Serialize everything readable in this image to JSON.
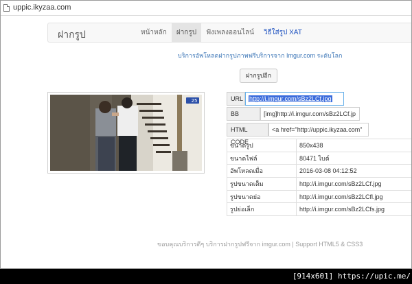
{
  "browser": {
    "url": "uppic.ikyzaa.com"
  },
  "navbar": {
    "brand": "ฝากรูป",
    "items": [
      {
        "label": "หน้าหลัก",
        "active": false
      },
      {
        "label": "ฝากรูป",
        "active": true
      },
      {
        "label": "ฟังเพลงออนไลน์",
        "active": false
      },
      {
        "label": "วิธีใส่รูป XAT",
        "active": false
      }
    ]
  },
  "service_text": "บริการอัพโหลดฝากรูปภาพฟรีบริการจาก Imgur.com ระดับโลก",
  "upload_button": "ฝากรูปอีก",
  "thumbnail": {
    "channel_badge": "25"
  },
  "codes": {
    "url_label": "URL",
    "url_value": "http://i.imgur.com/sBz2LCf.jpg",
    "bb_label": "BB CODE",
    "bb_value": "[img]http://i.imgur.com/sBz2LCf.jp",
    "html_label": "HTML CODE",
    "html_value": "<a href=\"http://uppic.ikyzaa.com\""
  },
  "info_rows": [
    {
      "label": "ขนาดรูป",
      "value": "850x438"
    },
    {
      "label": "ขนาดไฟล์",
      "value": "80471 ไบต์"
    },
    {
      "label": "อัพโหลดเมื่อ",
      "value": "2016-03-08 04:12:52"
    },
    {
      "label": "รูปขนาดเต็ม",
      "value": "http://i.imgur.com/sBz2LCf.jpg"
    },
    {
      "label": "รูปขนาดย่อ",
      "value": "http://i.imgur.com/sBz2LCfl.jpg"
    },
    {
      "label": "รูปย่อเล็ก",
      "value": "http://i.imgur.com/sBz2LCfs.jpg"
    }
  ],
  "footer": "ขอบคุณบริการดีๆ บริการฝากรูปฟรีจาก imgur.com | Support HTML5 & CSS3",
  "watermark": "[914x601] https://upic.me/",
  "colors": {
    "link": "#3f78b8",
    "selection": "#3b6cdc",
    "xat_link": "#1a4fbf"
  }
}
